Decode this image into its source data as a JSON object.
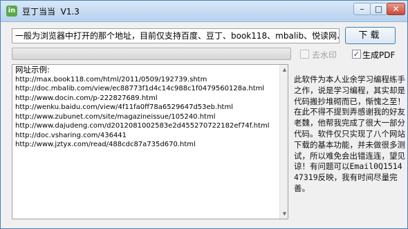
{
  "window": {
    "app_icon_text": "in",
    "title": "豆丁当当  V1.3",
    "controls": {
      "minimize": "–",
      "maximize": "□",
      "close": "✕"
    }
  },
  "url_input": {
    "value": "一般为浏览器中打开的那个地址，目前仅支持百度、豆丁、book118、mbalib、悦读网、畅想网"
  },
  "download_button": {
    "label": "下载"
  },
  "progress": {
    "value": 0
  },
  "options": {
    "watermark": {
      "label": "去水印",
      "checked": false,
      "enabled": false
    },
    "pdf": {
      "label": "生成PDF",
      "checked": true,
      "enabled": true
    }
  },
  "examples": {
    "title": "网址示例:",
    "urls": [
      "http://max.book118.com/html/2011/0509/192739.shtm",
      "http://doc.mbalib.com/view/ec88773f1d4c14c988c1f0479560128a.html",
      "http://www.docin.com/p-222827689.html",
      "http://wenku.baidu.com/view/4f11fa0ff78a6529647d53eb.html",
      "http://www.zubunet.com/site/magazineissue/105240.html",
      "http://www.dajudeng.com/d2012081002583e2d455270722182ef74f.html",
      "http://doc.vsharing.com/436441",
      "http://www.jztyx.com/read/488cdc87a735d670.html"
    ],
    "scroll_up": "▲",
    "scroll_down": "▼"
  },
  "about": {
    "text": "此软件为本人业余学习编程练手之作，说是学习编程，其实却是代码搬抄堆砌而已，惭愧之至！在此不得不提到弄感谢我的好友老魏，他帮我完成了很大一部分代码。软件仅只实现了八个网站下载的基本功能，并未做很多测试，所以难免会出错连连，望见谅！有问题可以Email0Q151447319反映，我有时间尽量完善。"
  },
  "colors": {
    "title_bar_top": "#d8e8f8",
    "title_bar_bottom": "#b7d1ee",
    "window_border": "#4a7fb5",
    "close_button": "#c9493a",
    "app_icon": "#5aa84a"
  }
}
